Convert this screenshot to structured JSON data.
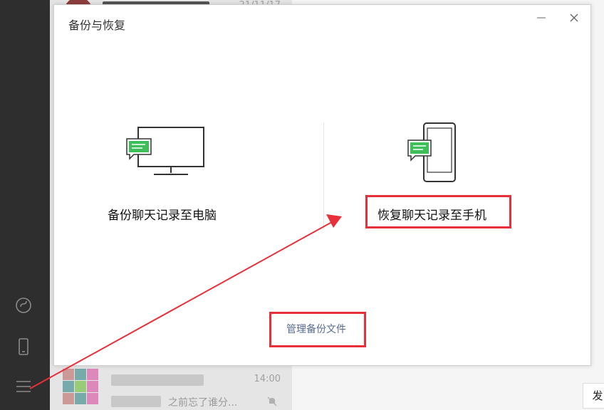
{
  "dialog": {
    "title": "备份与恢复",
    "backup_label": "备份聊天记录至电脑",
    "restore_label": "恢复聊天记录至手机",
    "manage_label": "管理备份文件"
  },
  "chatlist": {
    "top_item": {
      "time": "21/11/17"
    },
    "bottom_item": {
      "time": "14:00",
      "preview": "之前忘了谁分..."
    }
  },
  "rightarea": {
    "send_label": "发"
  },
  "colors": {
    "accent_red": "#e8303a",
    "link_blue": "#576b95",
    "sidebar": "#2e2e2e"
  }
}
